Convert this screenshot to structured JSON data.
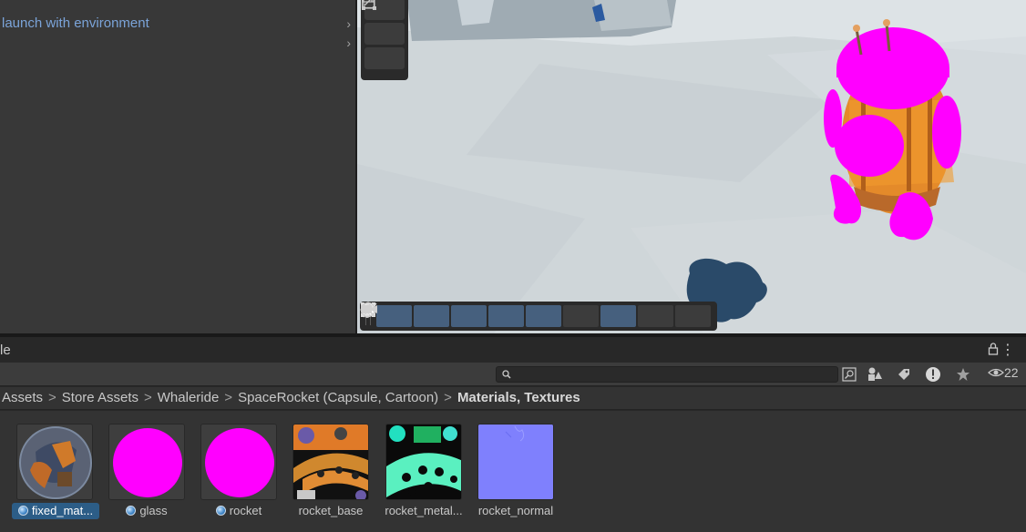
{
  "hierarchy": {
    "rows": [
      {
        "label": "launch with environment",
        "chevron": "›"
      },
      {
        "label": "",
        "chevron": "›"
      }
    ]
  },
  "scene_view": {
    "vertical_tools": [
      "move-tool-icon",
      "scale-tool-icon",
      "rect-tool-icon",
      "transform-tool-icon"
    ],
    "overlay_tools": [
      "rect-tool-icon",
      "align-icon",
      "grid-snap-icon",
      "shading-icon",
      "layers-icon",
      "search-icon",
      "pivot-icon",
      "camera-icon",
      "compass-icon"
    ]
  },
  "project": {
    "tab_title": "le",
    "more_glyph": "⋮",
    "hidden_count": "22",
    "breadcrumb": [
      "Assets",
      "Store Assets",
      "Whaleride",
      "SpaceRocket (Capsule, Cartoon)",
      "Materials, Textures"
    ],
    "breadcrumb_sep": ">",
    "assets": [
      {
        "name": "fixed_mat...",
        "kind": "material",
        "selected": true
      },
      {
        "name": "glass",
        "kind": "material",
        "selected": false
      },
      {
        "name": "rocket",
        "kind": "material",
        "selected": false
      },
      {
        "name": "rocket_base",
        "kind": "texture",
        "selected": false
      },
      {
        "name": "rocket_metal...",
        "kind": "texture",
        "selected": false
      },
      {
        "name": "rocket_normal",
        "kind": "texture",
        "selected": false
      }
    ]
  },
  "colors": {
    "missing_shader": "#ff00ff",
    "selection": "#2c5d87",
    "link_text": "#7ba4d9",
    "normal_map": "#7f80fd"
  }
}
